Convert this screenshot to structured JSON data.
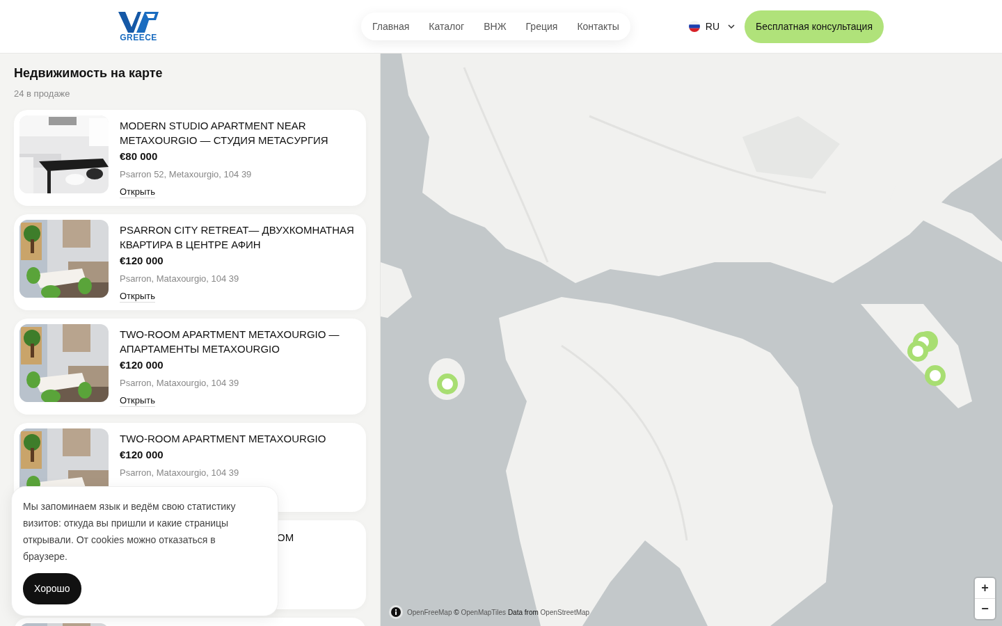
{
  "logo": {
    "text": "GREECE"
  },
  "nav": [
    {
      "label": "Главная"
    },
    {
      "label": "Каталог"
    },
    {
      "label": "ВНЖ"
    },
    {
      "label": "Греция"
    },
    {
      "label": "Контакты"
    }
  ],
  "language": {
    "code": "RU"
  },
  "cta_button": "Бесплатная консультация",
  "sidebar": {
    "title": "Недвижимость на карте",
    "count": "24 в продаже"
  },
  "listings": [
    {
      "kind": "full",
      "title": "MODERN STUDIO APARTMENT NEAR METAXOURGIO — СТУДИЯ METACУРГИЯ",
      "price": "€80 000",
      "address": "Psarron 52, Metaxourgio, 104 39",
      "link": "Открыть"
    },
    {
      "kind": "full",
      "title": "PSARRON CITY RETREAT— ДВУХКОМНАТНАЯ КВАРТИРА В ЦЕНТРЕ АФИН",
      "price": "€120 000",
      "address": "Psarron, Mataxourgio, 104 39",
      "link": "Открыть"
    },
    {
      "kind": "full",
      "title": "TWO-ROOM APARTMENT METAXOURGIO — АПАРТАМЕНТЫ METAXOURGIO",
      "price": "€120 000",
      "address": "Psarron, Mataxourgio, 104 39",
      "link": "Открыть"
    },
    {
      "kind": "full",
      "title": "TWO-ROOM APARTMENT METAXOURGIO",
      "price": "€120 000",
      "address": "Psarron, Mataxourgio, 104 39"
    },
    {
      "kind": "covered",
      "title": "OM"
    },
    {
      "kind": "edge"
    }
  ],
  "cookie_banner": {
    "text": "Мы запоминаем язык и ведём свою статистику визитов: откуда вы пришли и какие страницы открывали. От cookies можно отказаться в браузере.",
    "button": "Хорошо"
  },
  "map": {
    "attribution": [
      {
        "text": "OpenFreeMap",
        "link": true
      },
      {
        "text": "©",
        "link": false
      },
      {
        "text": "OpenMapTiles",
        "link": true
      },
      {
        "text": "Data from",
        "link": false
      },
      {
        "text": "OpenStreetMap",
        "link": true
      }
    ],
    "zoom_in": "+",
    "zoom_out": "−"
  }
}
